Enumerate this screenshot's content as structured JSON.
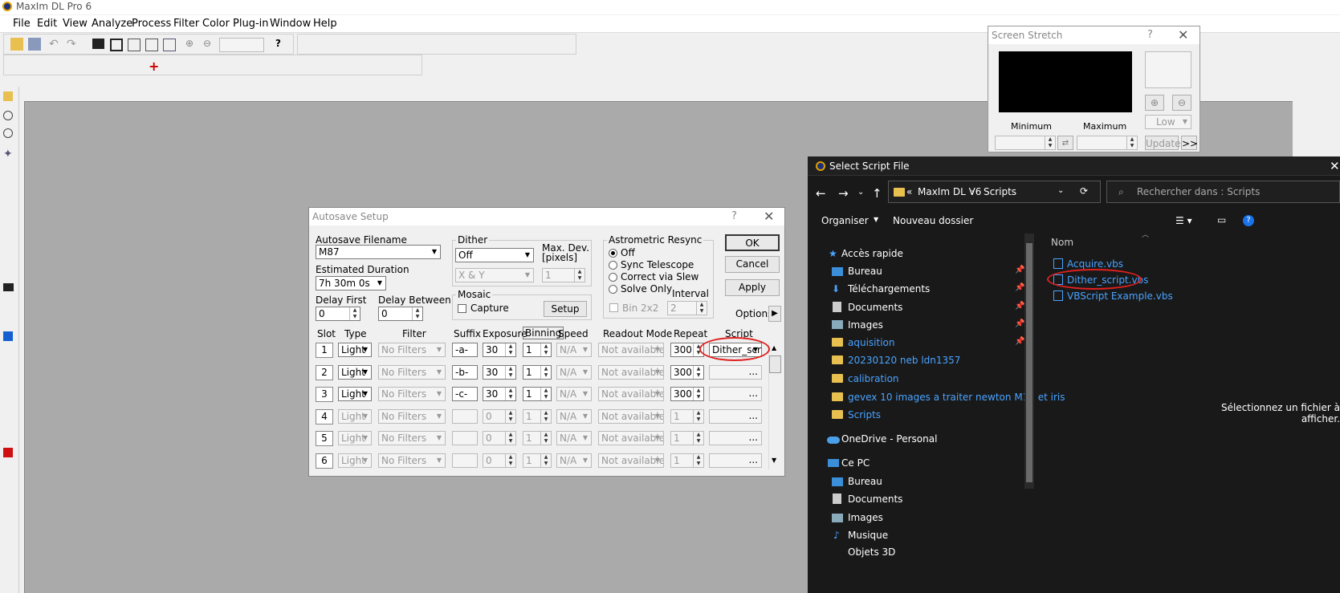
{
  "app": {
    "title": "MaxIm DL Pro 6"
  },
  "menu": [
    "File",
    "Edit",
    "View",
    "Analyze",
    "Process",
    "Filter",
    "Color",
    "Plug-in",
    "Window",
    "Help"
  ],
  "screen_stretch": {
    "title": "Screen Stretch",
    "help": "?",
    "close": "✕",
    "minimum_label": "Minimum",
    "maximum_label": "Maximum",
    "mode_value": "Low",
    "update_label": "Update",
    "more_label": ">>"
  },
  "autosave": {
    "title": "Autosave Setup",
    "help": "?",
    "close": "✕",
    "filename_label": "Autosave Filename",
    "filename_value": "M87",
    "duration_label": "Estimated Duration",
    "duration_value": "7h 30m 0s",
    "delay_first_label": "Delay First",
    "delay_first_value": "0",
    "delay_between_label": "Delay Between",
    "delay_between_value": "0",
    "dither_label": "Dither",
    "dither_value": "Off",
    "dither_axis": "X & Y",
    "maxdev_label": "Max. Dev.",
    "maxdev_unit": "[pixels]",
    "maxdev_value": "1",
    "mosaic_label": "Mosaic",
    "capture_label": "Capture",
    "setup_label": "Setup",
    "resync_label": "Astrometric Resync",
    "resync_options": [
      "Off",
      "Sync Telescope",
      "Correct via Slew",
      "Solve Only"
    ],
    "bin_label": "Bin 2x2",
    "interval_label": "Interval",
    "interval_value": "2",
    "ok_label": "OK",
    "cancel_label": "Cancel",
    "apply_label": "Apply",
    "options_label": "Options",
    "columns": [
      "Slot",
      "Type",
      "Filter",
      "Suffix",
      "Exposure",
      "Binning",
      "Speed",
      "Readout Mode",
      "Repeat",
      "Script"
    ],
    "rows": [
      {
        "slot": "1",
        "type": "Light",
        "filter": "No Filters",
        "suffix": "-a-",
        "exposure": "30",
        "binning": "1",
        "speed": "N/A",
        "readout": "Not available",
        "repeat": "300",
        "script": "Dither_scr"
      },
      {
        "slot": "2",
        "type": "Light",
        "filter": "No Filters",
        "suffix": "-b-",
        "exposure": "30",
        "binning": "1",
        "speed": "N/A",
        "readout": "Not available",
        "repeat": "300",
        "script": "..."
      },
      {
        "slot": "3",
        "type": "Light",
        "filter": "No Filters",
        "suffix": "-c-",
        "exposure": "30",
        "binning": "1",
        "speed": "N/A",
        "readout": "Not available",
        "repeat": "300",
        "script": "..."
      },
      {
        "slot": "4",
        "type": "Light",
        "filter": "No Filters",
        "suffix": "",
        "exposure": "0",
        "binning": "1",
        "speed": "N/A",
        "readout": "Not available",
        "repeat": "1",
        "script": "..."
      },
      {
        "slot": "5",
        "type": "Light",
        "filter": "No Filters",
        "suffix": "",
        "exposure": "0",
        "binning": "1",
        "speed": "N/A",
        "readout": "Not available",
        "repeat": "1",
        "script": "..."
      },
      {
        "slot": "6",
        "type": "Light",
        "filter": "No Filters",
        "suffix": "",
        "exposure": "0",
        "binning": "1",
        "speed": "N/A",
        "readout": "Not available",
        "repeat": "1",
        "script": "..."
      }
    ]
  },
  "explorer": {
    "title": "Select Script File",
    "close": "✕",
    "path": [
      "«",
      "MaxIm DL V6",
      "Scripts"
    ],
    "search_placeholder": "Rechercher dans : Scripts",
    "organize": "Organiser",
    "new_folder": "Nouveau dossier",
    "col_name": "Nom",
    "quick_access": "Accès rapide",
    "nav_items": [
      "Bureau",
      "Téléchargements",
      "Documents",
      "Images",
      "aquisition",
      "20230120 neb ldn1357",
      "calibration",
      "gevex 10 images a traiter newton M13 et iris",
      "Scripts"
    ],
    "onedrive": "OneDrive - Personal",
    "this_pc": "Ce PC",
    "pc_items": [
      "Bureau",
      "Documents",
      "Images",
      "Musique",
      "Objets 3D"
    ],
    "files": [
      "Acquire.vbs",
      "Dither_script.vbs",
      "VBScript Example.vbs"
    ],
    "preview_text": "Sélectionnez un fichier à afficher."
  },
  "colors": {
    "highlight_ellipse": "#e02020",
    "link_blue": "#4aa3ff"
  }
}
